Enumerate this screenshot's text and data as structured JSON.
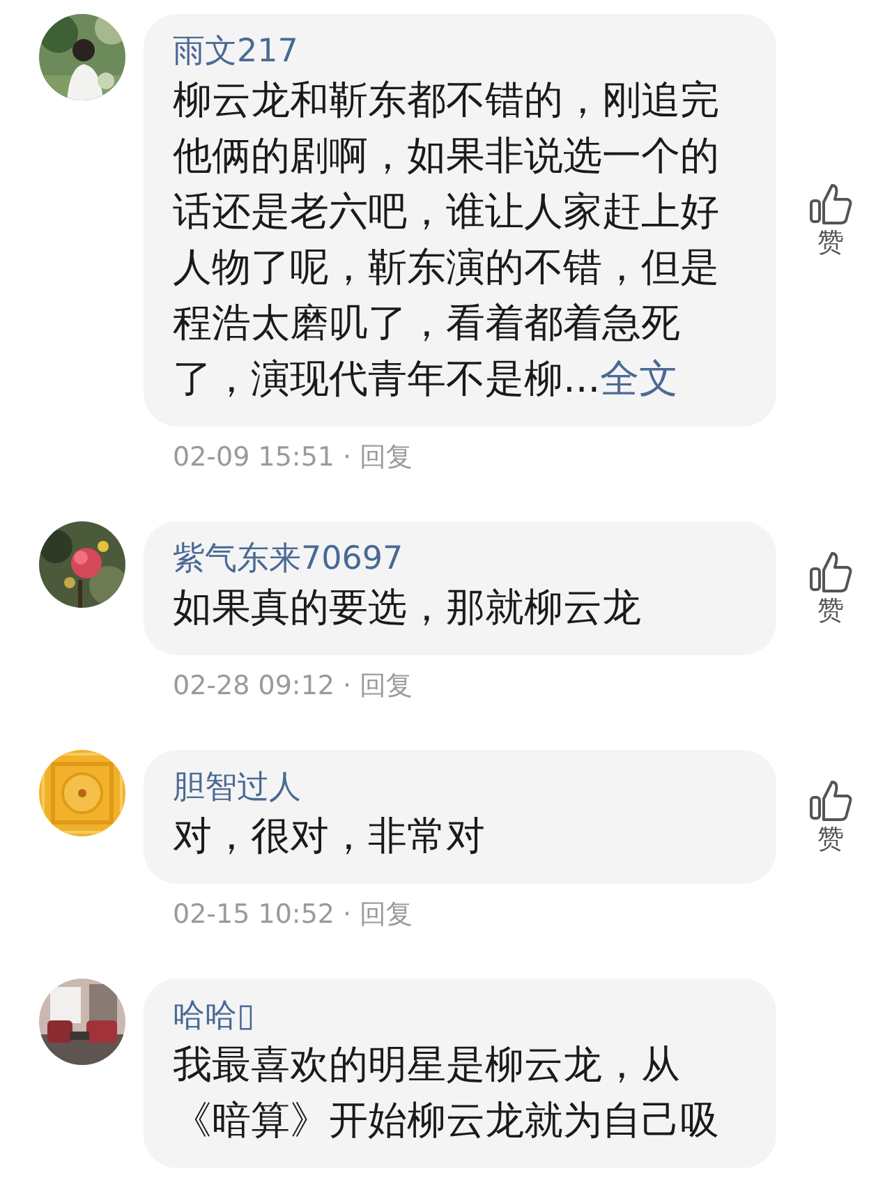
{
  "comments": [
    {
      "user": "雨文217",
      "text": "柳云龙和靳东都不错的，刚追完他俩的剧啊，如果非说选一个的话还是老六吧，谁让人家赶上好人物了呢，靳东演的不错，但是程浩太磨叽了，看着都着急死了，演现代青年不是柳...",
      "more": "全文",
      "time": "02-09 15:51 ·",
      "reply": "回复",
      "like": "赞"
    },
    {
      "user": "紫气东来70697",
      "text": "如果真的要选，那就柳云龙",
      "time": "02-28 09:12 ·",
      "reply": "回复",
      "like": "赞"
    },
    {
      "user": "胆智过人",
      "text": "对，很对，非常对",
      "time": "02-15 10:52 ·",
      "reply": "回复",
      "like": "赞"
    },
    {
      "user": "哈哈▯",
      "text": "我最喜欢的明星是柳云龙，从《暗算》开始柳云龙就为自己吸"
    }
  ]
}
